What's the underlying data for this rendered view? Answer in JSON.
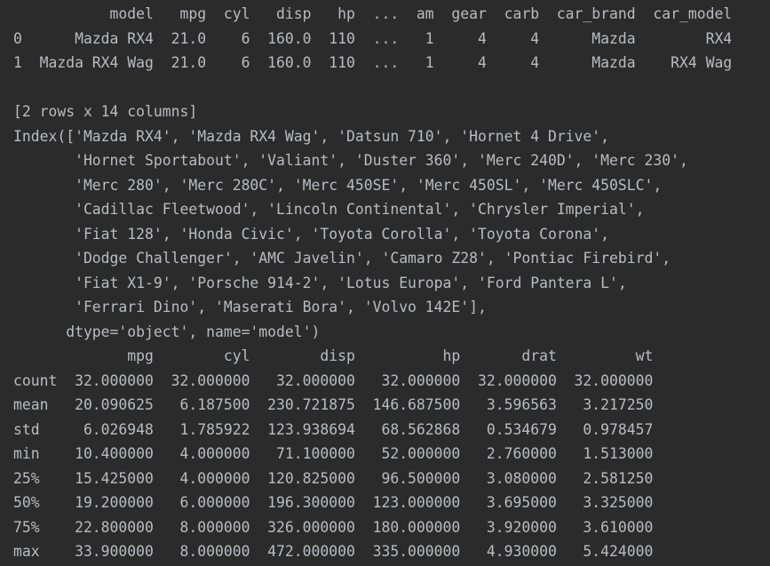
{
  "console": {
    "lines": [
      "           model   mpg  cyl   disp   hp  ...  am  gear  carb  car_brand  car_model",
      "0      Mazda RX4  21.0    6  160.0  110  ...   1     4     4      Mazda        RX4",
      "1  Mazda RX4 Wag  21.0    6  160.0  110  ...   1     4     4      Mazda    RX4 Wag",
      "",
      "[2 rows x 14 columns]",
      "Index(['Mazda RX4', 'Mazda RX4 Wag', 'Datsun 710', 'Hornet 4 Drive',",
      "       'Hornet Sportabout', 'Valiant', 'Duster 360', 'Merc 240D', 'Merc 230',",
      "       'Merc 280', 'Merc 280C', 'Merc 450SE', 'Merc 450SL', 'Merc 450SLC',",
      "       'Cadillac Fleetwood', 'Lincoln Continental', 'Chrysler Imperial',",
      "       'Fiat 128', 'Honda Civic', 'Toyota Corolla', 'Toyota Corona',",
      "       'Dodge Challenger', 'AMC Javelin', 'Camaro Z28', 'Pontiac Firebird',",
      "       'Fiat X1-9', 'Porsche 914-2', 'Lotus Europa', 'Ford Pantera L',",
      "       'Ferrari Dino', 'Maserati Bora', 'Volvo 142E'],",
      "      dtype='object', name='model')",
      "             mpg        cyl        disp          hp       drat         wt",
      "count  32.000000  32.000000   32.000000   32.000000  32.000000  32.000000",
      "mean   20.090625   6.187500  230.721875  146.687500   3.596563   3.217250",
      "std     6.026948   1.785922  123.938694   68.562868   0.534679   0.978457",
      "min    10.400000   4.000000   71.100000   52.000000   2.760000   1.513000",
      "25%    15.425000   4.000000  120.825000   96.500000   3.080000   2.581250",
      "50%    19.200000   6.000000  196.300000  123.000000   3.695000   3.325000",
      "75%    22.800000   8.000000  326.000000  180.000000   3.920000   3.610000",
      "max    33.900000   8.000000  472.000000  335.000000   4.930000   5.424000"
    ]
  }
}
